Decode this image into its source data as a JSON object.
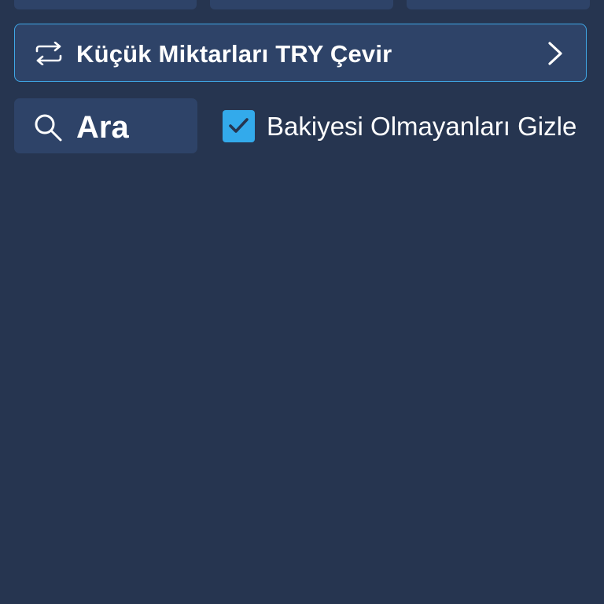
{
  "top_tabs": [
    {
      "id": "tab-1"
    },
    {
      "id": "tab-2"
    },
    {
      "id": "tab-3"
    }
  ],
  "convert_banner": {
    "label": "Küçük Miktarları TRY Çevir",
    "icon": "swap-arrows-icon",
    "trailing_icon": "chevron-right-icon",
    "border_color": "#3fa7e6"
  },
  "search": {
    "placeholder": "Ara",
    "icon": "search-icon"
  },
  "hide_zero_balances": {
    "label": "Bakiyesi Olmayanları Gizle",
    "checked": true,
    "accent_color": "#33aaeb"
  },
  "colors": {
    "background": "#263550",
    "surface": "#2e4368",
    "text": "#ffffff"
  }
}
